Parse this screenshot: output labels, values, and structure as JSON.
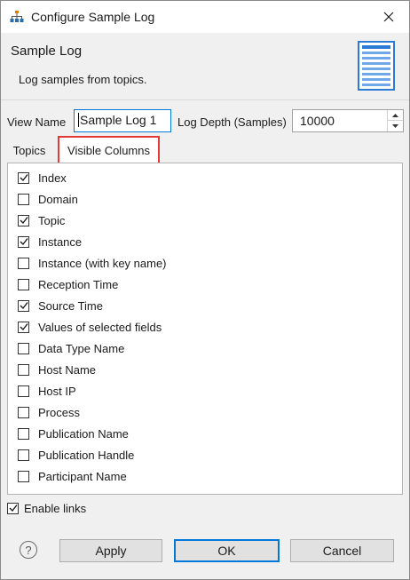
{
  "window": {
    "title": "Configure Sample Log",
    "icon": "hierarchy-icon"
  },
  "header": {
    "title": "Sample Log",
    "description": "Log samples from topics.",
    "image": "document-list-icon"
  },
  "form": {
    "view_name_label": "View Name",
    "view_name_value": "Sample Log 1",
    "log_depth_label": "Log Depth (Samples)",
    "log_depth_value": "10000"
  },
  "tabs": [
    {
      "label": "Topics",
      "selected": false
    },
    {
      "label": "Visible Columns",
      "selected": true
    }
  ],
  "columns": [
    {
      "label": "Index",
      "checked": true
    },
    {
      "label": "Domain",
      "checked": false
    },
    {
      "label": "Topic",
      "checked": true
    },
    {
      "label": "Instance",
      "checked": true
    },
    {
      "label": "Instance (with key name)",
      "checked": false
    },
    {
      "label": "Reception Time",
      "checked": false
    },
    {
      "label": "Source Time",
      "checked": true
    },
    {
      "label": "Values of selected fields",
      "checked": true
    },
    {
      "label": "Data Type Name",
      "checked": false
    },
    {
      "label": "Host Name",
      "checked": false
    },
    {
      "label": "Host IP",
      "checked": false
    },
    {
      "label": "Process",
      "checked": false
    },
    {
      "label": "Publication Name",
      "checked": false
    },
    {
      "label": "Publication Handle",
      "checked": false
    },
    {
      "label": "Participant Name",
      "checked": false
    }
  ],
  "enable_links": {
    "label": "Enable links",
    "checked": true
  },
  "footer": {
    "help_glyph": "?",
    "apply_label": "Apply",
    "ok_label": "OK",
    "cancel_label": "Cancel"
  },
  "colors": {
    "accent": "#0078d7",
    "highlight": "#e53935",
    "background": "#f0f0f0"
  }
}
